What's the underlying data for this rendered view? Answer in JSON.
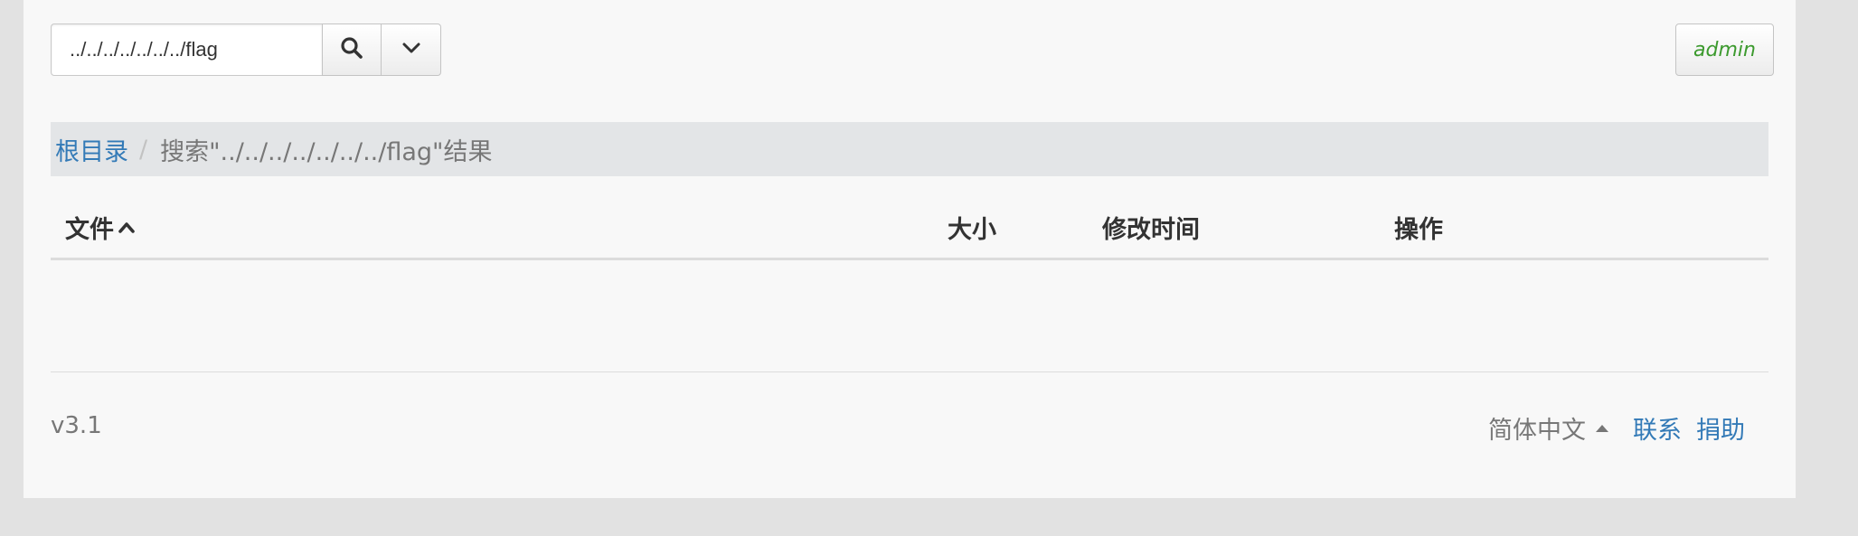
{
  "search": {
    "value": "../../../../../../../flag",
    "search_button_icon": "search-icon",
    "dropdown_icon": "chevron-down-icon"
  },
  "user": {
    "name": "admin"
  },
  "breadcrumb": {
    "root": "根目录",
    "separator": "/",
    "current": "搜索\"../../../../../../../flag\"结果"
  },
  "table": {
    "columns": {
      "name": "文件",
      "size": "大小",
      "mtime": "修改时间",
      "ops": "操作"
    },
    "sort_icon": "chevron-up-icon",
    "rows": []
  },
  "footer": {
    "version": "v3.1",
    "language": "简体中文",
    "language_icon": "caret-up-icon",
    "contact": "联系",
    "donate": "捐助"
  },
  "colors": {
    "link": "#337ab7",
    "admin": "#3c9a2e",
    "muted": "#777777",
    "breadcrumb_bg": "#e3e5e7"
  }
}
